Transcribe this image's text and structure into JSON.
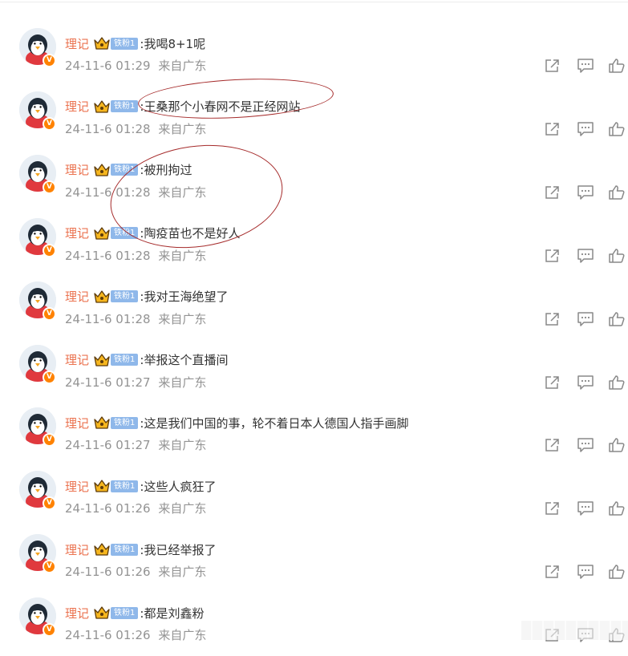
{
  "comments": [
    {
      "username": "理记",
      "fan_badge": "铁粉1",
      "text": ":我喝8+1呢",
      "date": "24-11-6 01:29",
      "location": "来自广东"
    },
    {
      "username": "理记",
      "fan_badge": "铁粉1",
      "text": ":王桑那个小春网不是正经网站",
      "date": "24-11-6 01:28",
      "location": "来自广东"
    },
    {
      "username": "理记",
      "fan_badge": "铁粉1",
      "text": ":被刑拘过",
      "date": "24-11-6 01:28",
      "location": "来自广东"
    },
    {
      "username": "理记",
      "fan_badge": "铁粉1",
      "text": ":陶疫苗也不是好人",
      "date": "24-11-6 01:28",
      "location": "来自广东"
    },
    {
      "username": "理记",
      "fan_badge": "铁粉1",
      "text": ":我对王海绝望了",
      "date": "24-11-6 01:28",
      "location": "来自广东"
    },
    {
      "username": "理记",
      "fan_badge": "铁粉1",
      "text": ":举报这个直播间",
      "date": "24-11-6 01:27",
      "location": "来自广东"
    },
    {
      "username": "理记",
      "fan_badge": "铁粉1",
      "text": ":这是我们中国的事，轮不着日本人德国人指手画脚",
      "date": "24-11-6 01:27",
      "location": "来自广东"
    },
    {
      "username": "理记",
      "fan_badge": "铁粉1",
      "text": ":这些人疯狂了",
      "date": "24-11-6 01:26",
      "location": "来自广东"
    },
    {
      "username": "理记",
      "fan_badge": "铁粉1",
      "text": ":我已经举报了",
      "date": "24-11-6 01:26",
      "location": "来自广东"
    },
    {
      "username": "理记",
      "fan_badge": "铁粉1",
      "text": ":都是刘鑫粉",
      "date": "24-11-6 01:26",
      "location": "来自广东"
    }
  ],
  "avatar_badge": "V",
  "icons": {
    "avatar": "penguin-avatar",
    "verified": "verified-v-icon",
    "fan_level": "crown-icon",
    "actions": [
      "share-icon",
      "comment-icon",
      "like-icon"
    ]
  },
  "colors": {
    "username": "#eb7350",
    "comment_text": "#333333",
    "meta_text": "#939393",
    "fan_badge_bg": "#8fb8ea",
    "verified_badge": "#ff8200",
    "annotation_circle": "#a52a2a",
    "action_icon": "#888888"
  }
}
